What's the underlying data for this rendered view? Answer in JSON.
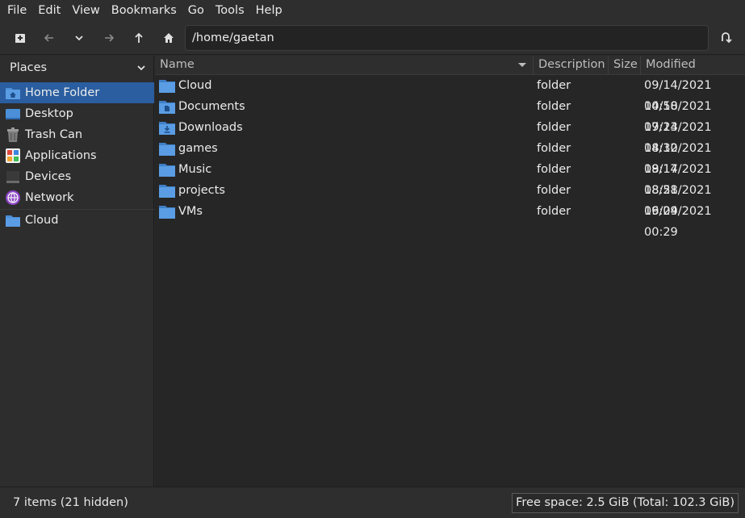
{
  "menubar": {
    "items": [
      "File",
      "Edit",
      "View",
      "Bookmarks",
      "Go",
      "Tools",
      "Help"
    ]
  },
  "toolbar": {
    "buttons": [
      {
        "name": "new-tab-button",
        "icon": "new-tab-icon"
      },
      {
        "name": "back-button",
        "icon": "arrow-left-icon"
      },
      {
        "name": "history-dropdown-button",
        "icon": "chevron-down-icon"
      },
      {
        "name": "forward-button",
        "icon": "arrow-right-icon"
      },
      {
        "name": "up-button",
        "icon": "arrow-up-icon"
      },
      {
        "name": "home-button",
        "icon": "home-icon"
      },
      {
        "name": "go-button",
        "icon": "go-icon"
      }
    ],
    "path": "/home/gaetan"
  },
  "sidebar": {
    "header": "Places",
    "items": [
      {
        "label": "Home Folder",
        "icon": "home-folder-icon",
        "selected": true
      },
      {
        "label": "Desktop",
        "icon": "desktop-icon"
      },
      {
        "label": "Trash Can",
        "icon": "trash-icon"
      },
      {
        "label": "Applications",
        "icon": "applications-icon"
      },
      {
        "label": "Devices",
        "icon": "devices-icon"
      },
      {
        "label": "Network",
        "icon": "network-icon"
      },
      {
        "label": "Cloud",
        "icon": "folder-icon"
      }
    ]
  },
  "filelist": {
    "columns": [
      "Name",
      "Description",
      "Size",
      "Modified"
    ],
    "rows": [
      {
        "name": "Cloud",
        "description": "folder",
        "size": "",
        "modified": "09/14/2021 10:58",
        "icon": "folder-icon"
      },
      {
        "name": "Documents",
        "description": "folder",
        "size": "",
        "modified": "04/10/2021 17:23",
        "icon": "documents-folder-icon"
      },
      {
        "name": "Downloads",
        "description": "folder",
        "size": "",
        "modified": "09/14/2021 18:32",
        "icon": "downloads-folder-icon"
      },
      {
        "name": "games",
        "description": "folder",
        "size": "",
        "modified": "04/10/2021 18:17",
        "icon": "folder-icon"
      },
      {
        "name": "Music",
        "description": "folder",
        "size": "",
        "modified": "09/14/2021 18:58",
        "icon": "folder-icon"
      },
      {
        "name": "projects",
        "description": "folder",
        "size": "",
        "modified": "08/21/2021 16:29",
        "icon": "folder-icon"
      },
      {
        "name": "VMs",
        "description": "folder",
        "size": "",
        "modified": "09/04/2021 00:29",
        "icon": "folder-icon"
      }
    ]
  },
  "statusbar": {
    "items_text": "7 items (21 hidden)",
    "free_space": "Free space: 2.5 GiB (Total: 102.3 GiB)"
  },
  "colors": {
    "selection": "#2a5ea0",
    "folder": "#4a8fd8"
  }
}
